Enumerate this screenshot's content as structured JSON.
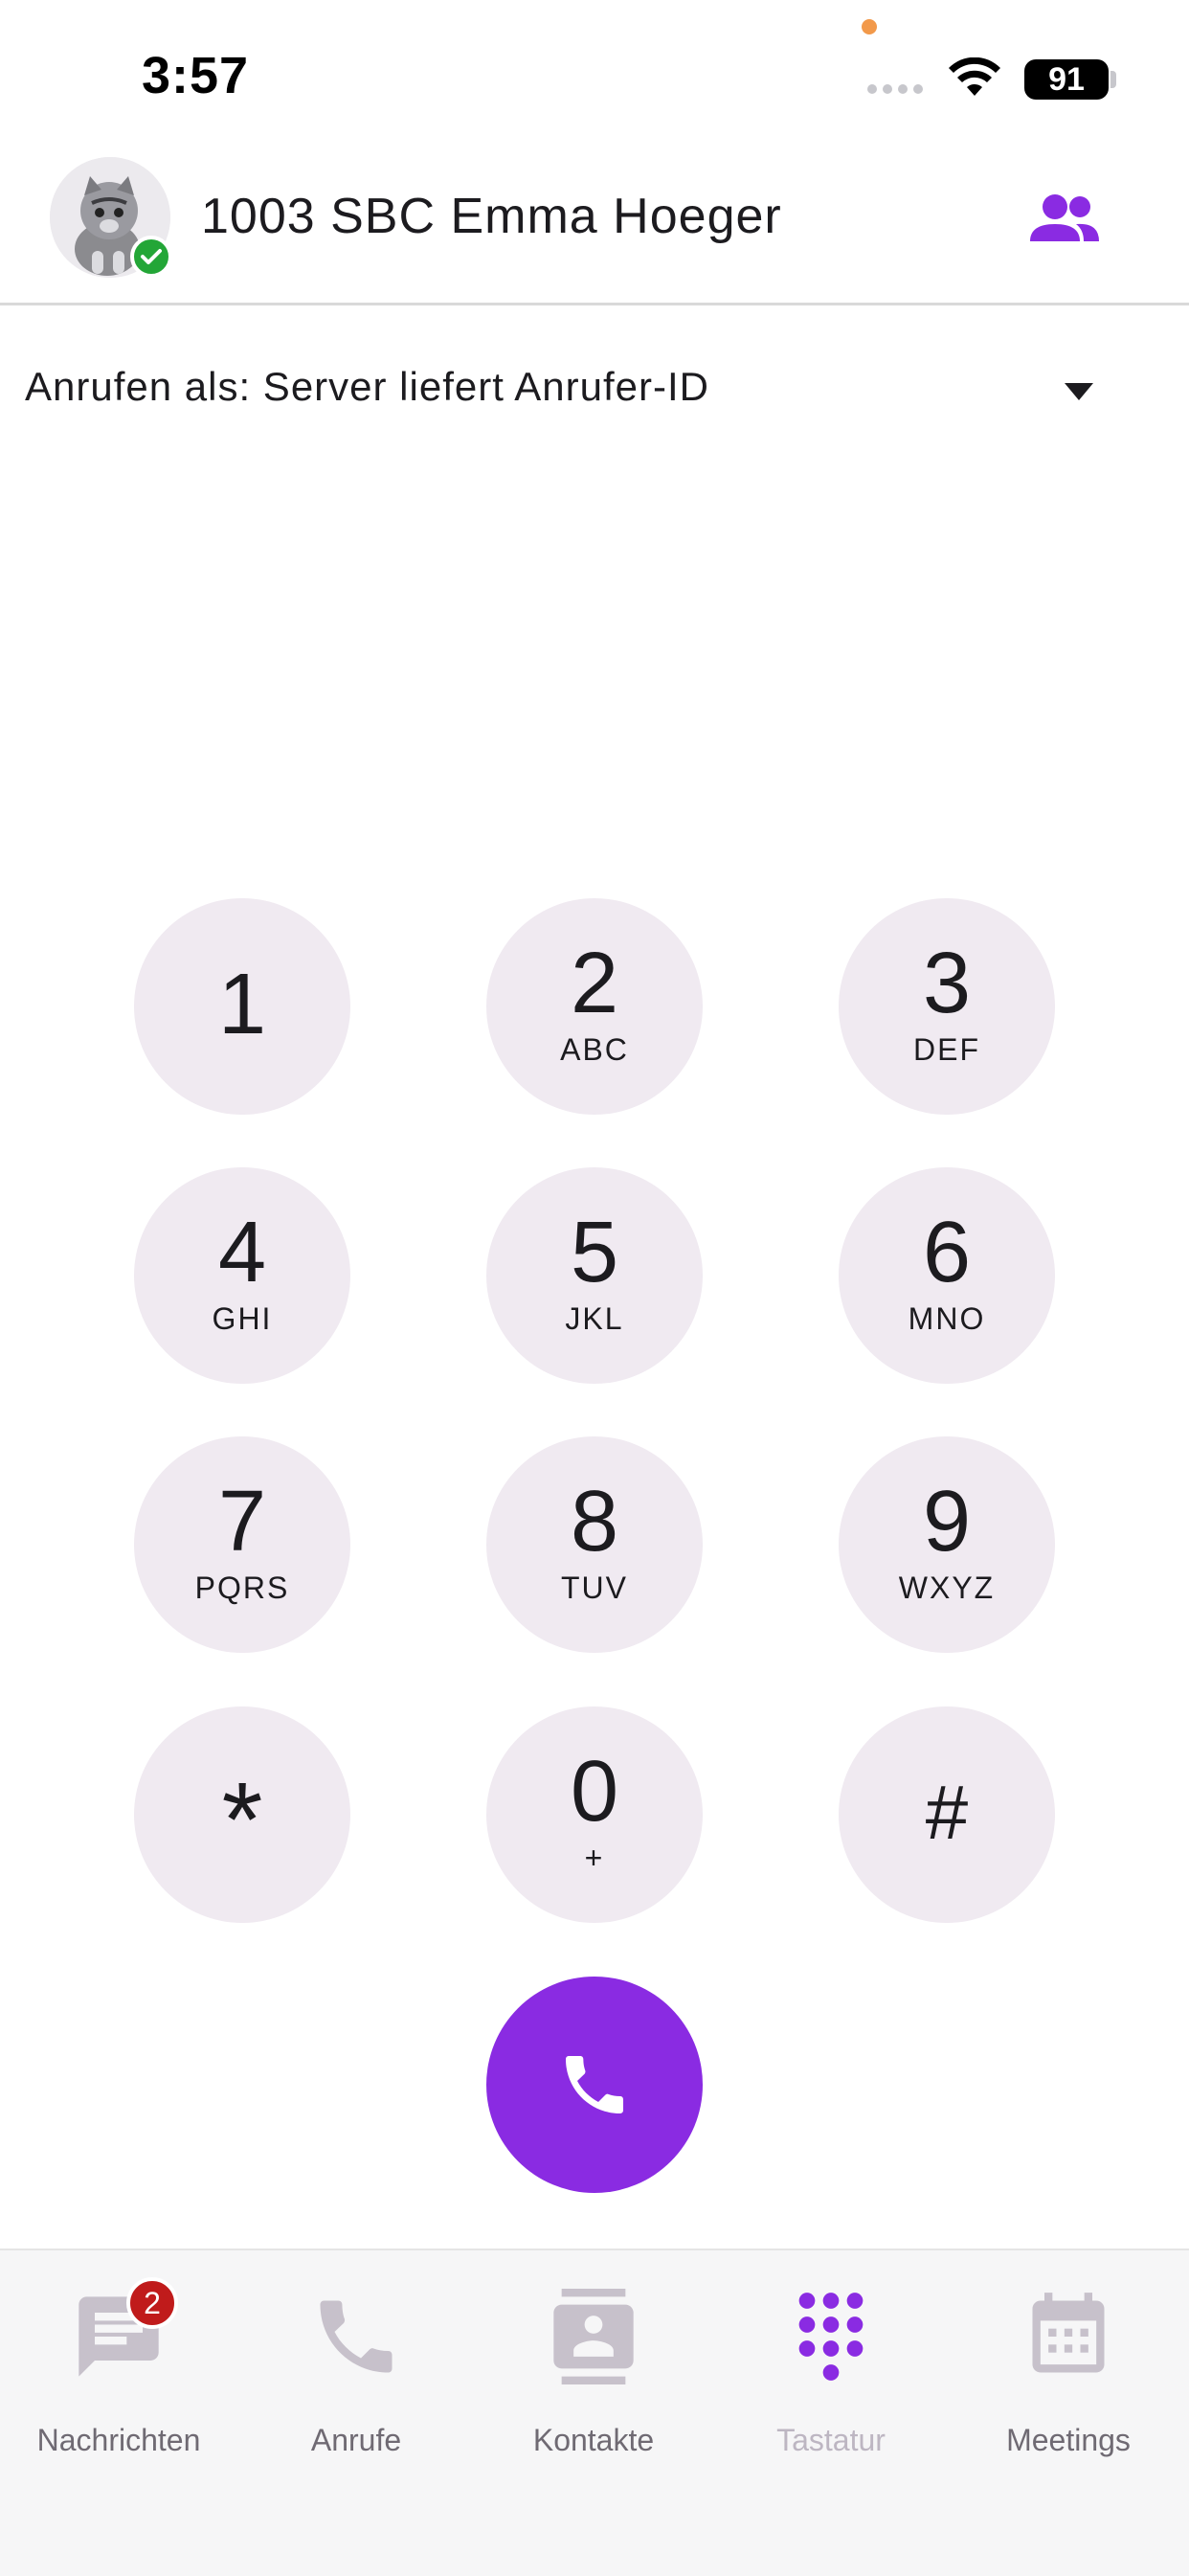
{
  "status_bar": {
    "time": "3:57",
    "battery": "91"
  },
  "header": {
    "title": "1003 SBC Emma Hoeger",
    "presence": "online"
  },
  "caller_id": {
    "label": "Anrufen als: Server liefert Anrufer-ID"
  },
  "keypad": {
    "keys": [
      {
        "digit": "1",
        "letters": ""
      },
      {
        "digit": "2",
        "letters": "ABC"
      },
      {
        "digit": "3",
        "letters": "DEF"
      },
      {
        "digit": "4",
        "letters": "GHI"
      },
      {
        "digit": "5",
        "letters": "JKL"
      },
      {
        "digit": "6",
        "letters": "MNO"
      },
      {
        "digit": "7",
        "letters": "PQRS"
      },
      {
        "digit": "8",
        "letters": "TUV"
      },
      {
        "digit": "9",
        "letters": "WXYZ"
      },
      {
        "digit": "*",
        "letters": ""
      },
      {
        "digit": "0",
        "letters": "+"
      },
      {
        "digit": "#",
        "letters": ""
      }
    ]
  },
  "bottom_nav": {
    "items": [
      {
        "label": "Nachrichten",
        "icon": "message-icon",
        "badge": "2"
      },
      {
        "label": "Anrufe",
        "icon": "phone-icon"
      },
      {
        "label": "Kontakte",
        "icon": "contacts-icon"
      },
      {
        "label": "Tastatur",
        "icon": "dialpad-icon",
        "active": true
      },
      {
        "label": "Meetings",
        "icon": "calendar-icon"
      }
    ]
  },
  "colors": {
    "accent": "#8a2be2",
    "key_background": "#f0eaf1",
    "presence_online": "#23a637",
    "badge": "#c01b1b"
  }
}
